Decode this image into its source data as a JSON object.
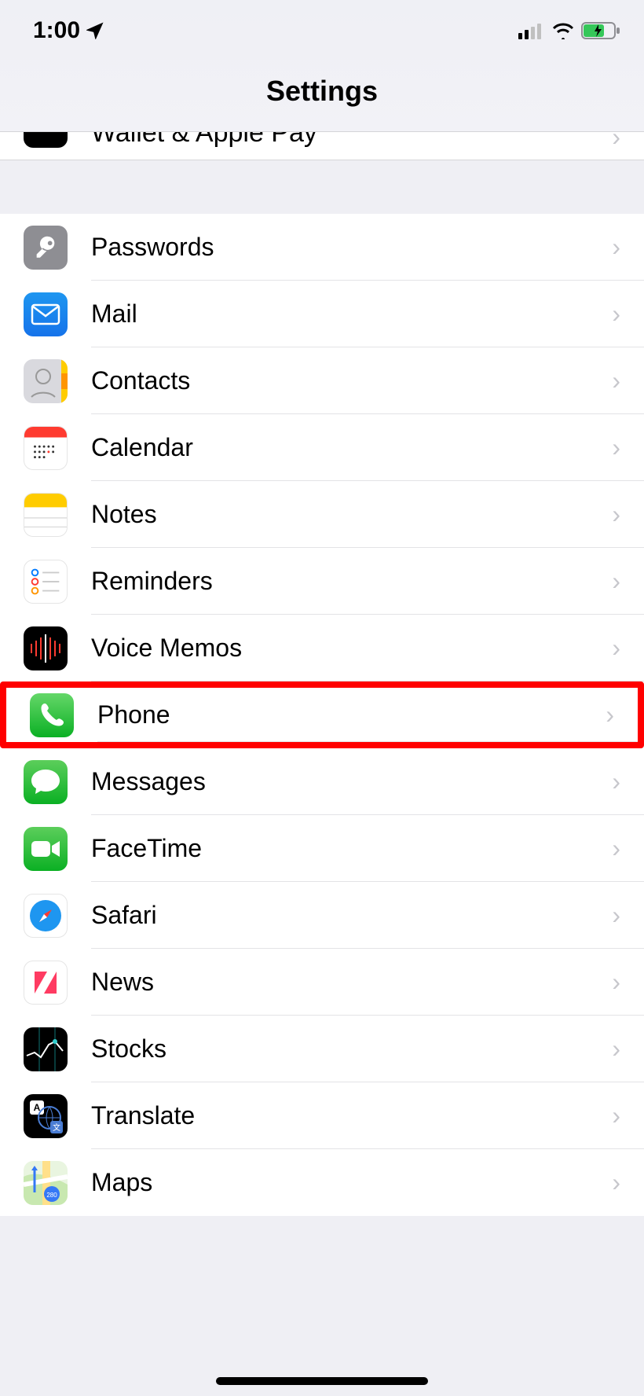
{
  "status": {
    "time": "1:00"
  },
  "header": {
    "title": "Settings"
  },
  "cutoff": {
    "label": "Wallet & Apple Pay"
  },
  "section2": [
    {
      "id": "passwords",
      "label": "Passwords"
    },
    {
      "id": "mail",
      "label": "Mail"
    },
    {
      "id": "contacts",
      "label": "Contacts"
    },
    {
      "id": "calendar",
      "label": "Calendar"
    },
    {
      "id": "notes",
      "label": "Notes"
    },
    {
      "id": "reminders",
      "label": "Reminders"
    },
    {
      "id": "voice-memos",
      "label": "Voice Memos"
    },
    {
      "id": "phone",
      "label": "Phone",
      "highlighted": true
    },
    {
      "id": "messages",
      "label": "Messages"
    },
    {
      "id": "facetime",
      "label": "FaceTime"
    },
    {
      "id": "safari",
      "label": "Safari"
    },
    {
      "id": "news",
      "label": "News"
    },
    {
      "id": "stocks",
      "label": "Stocks"
    },
    {
      "id": "translate",
      "label": "Translate"
    },
    {
      "id": "maps",
      "label": "Maps"
    }
  ]
}
